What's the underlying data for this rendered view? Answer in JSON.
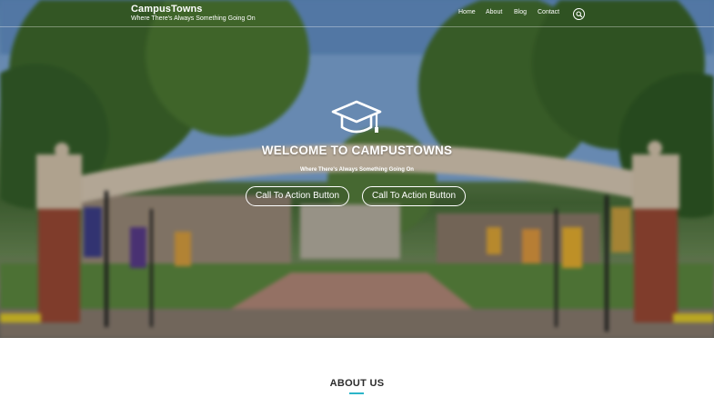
{
  "site": {
    "name": "CampusTowns",
    "tagline": "Where There's Always Something Going On"
  },
  "nav": {
    "items": [
      "Home",
      "About",
      "Blog",
      "Contact"
    ]
  },
  "icons": {
    "search": "search-icon",
    "hero": "graduation-cap-icon"
  },
  "hero": {
    "title": "WELCOME TO CAMPUSTOWNS",
    "subtitle": "Where There's Always Something Going On",
    "buttons": [
      "Call To Action Button",
      "Call To Action Button"
    ]
  },
  "sections": {
    "about_title": "ABOUT US"
  },
  "colors": {
    "accent": "#2bb5c9",
    "text_dark": "#2b2b2b",
    "hero_text": "#ffffff"
  }
}
